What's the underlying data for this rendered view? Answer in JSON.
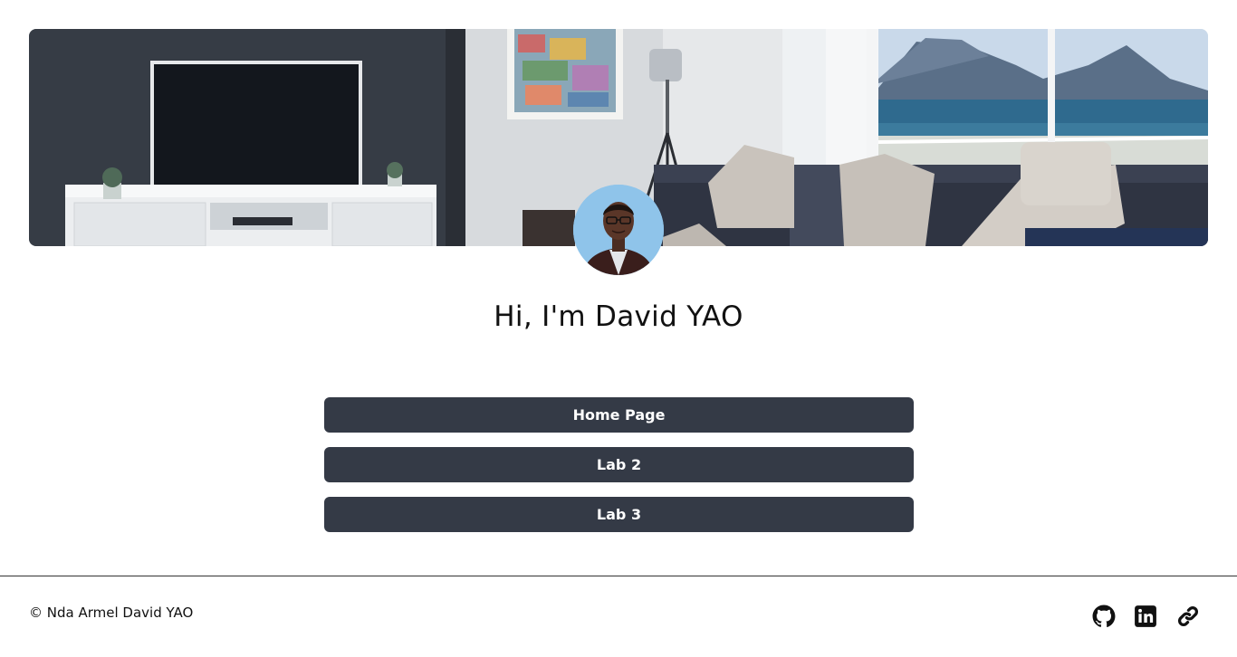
{
  "profile": {
    "greeting": "Hi, I'm David YAO",
    "banner_image": "living-room-banner",
    "avatar_image": "profile-photo"
  },
  "links": [
    {
      "label": "Home Page"
    },
    {
      "label": "Lab 2"
    },
    {
      "label": "Lab 3"
    }
  ],
  "footer": {
    "copyright": "© Nda Armel David YAO",
    "social": [
      {
        "icon": "github-icon"
      },
      {
        "icon": "linkedin-icon"
      },
      {
        "icon": "link-icon"
      }
    ]
  },
  "colors": {
    "button_bg": "#343a46",
    "button_text": "#ffffff",
    "text": "#111111",
    "background": "#ffffff"
  }
}
